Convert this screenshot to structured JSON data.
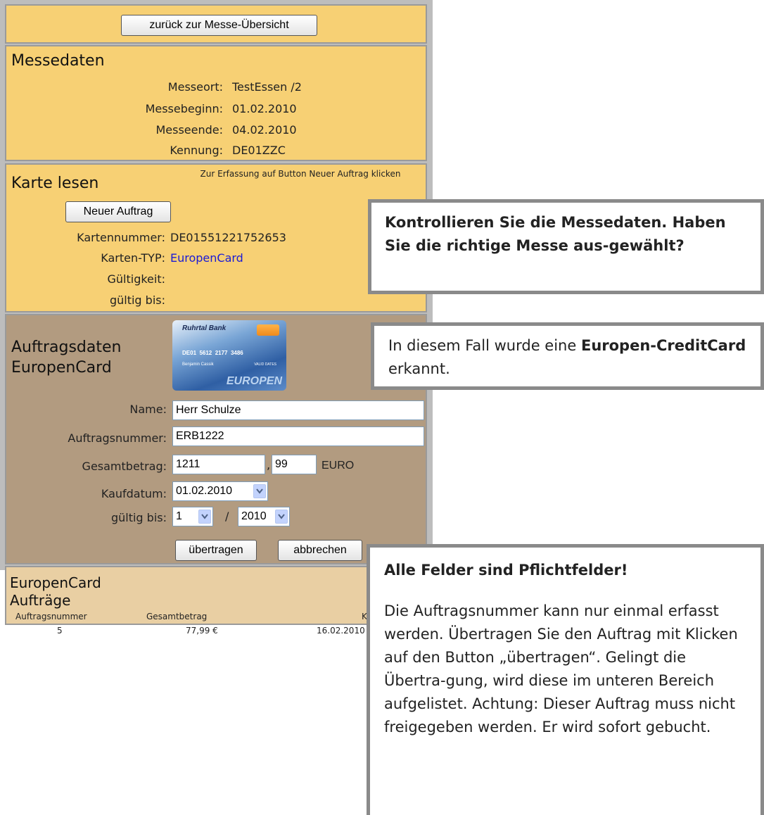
{
  "back_button": "zurück zur Messe-Übersicht",
  "messedaten": {
    "title": "Messedaten",
    "rows": [
      {
        "label": "Messeort:",
        "value": "TestEssen /2"
      },
      {
        "label": "Messebeginn:",
        "value": "01.02.2010"
      },
      {
        "label": "Messeende:",
        "value": "04.02.2010"
      },
      {
        "label": "Kennung:",
        "value": "DE01ZZC"
      }
    ]
  },
  "karte": {
    "title": "Karte lesen",
    "hint": "Zur Erfassung auf Button Neuer Auftrag klicken",
    "new_order_button": "Neuer Auftrag",
    "rows": [
      {
        "label": "Kartennummer:",
        "value": "DE01551221752653"
      },
      {
        "label": "Karten-TYP:",
        "value": "EuropenCard"
      },
      {
        "label": "Gültigkeit:",
        "value": ""
      },
      {
        "label": "gültig bis:",
        "value": ""
      }
    ],
    "type_color": "#1a1ad6"
  },
  "auftrag": {
    "title_line1": "Auftragsdaten",
    "title_line2": "EuropenCard",
    "card_image": {
      "bank": "Ruhrtal Bank",
      "number": "DE01  5612  2177  3486",
      "holder": "Benjamin Cassik",
      "valid_label": "VALID DATES",
      "brand": "EUROPEN"
    },
    "name_label": "Name:",
    "name_value": "Herr Schulze",
    "nr_label": "Auftragsnummer:",
    "nr_value": "ERB1222",
    "betrag_label": "Gesamtbetrag:",
    "betrag_euro": "1211",
    "betrag_cent": "99",
    "betrag_comma": ",",
    "currency": "EURO",
    "datum_label": "Kaufdatum:",
    "datum_value": "01.02.2010",
    "bis_label": "gültig bis:",
    "bis_month": "1",
    "bis_sep": "/",
    "bis_year": "2010",
    "submit_button": "übertragen",
    "cancel_button": "abbrechen"
  },
  "auftraege": {
    "title_line1": "EuropenCard",
    "title_line2": "Aufträge",
    "columns": [
      "Auftragsnummer",
      "Gesamtbetrag",
      "K"
    ],
    "rows": [
      [
        "5",
        "77,99 €",
        "16.02.2010"
      ]
    ]
  },
  "callouts": {
    "one": "Kontrollieren Sie die Messedaten. Haben Sie die richtige Messe aus-gewählt?",
    "two_prefix": "In diesem Fall wurde eine ",
    "two_bold": "Europen-CreditCard",
    "two_suffix": " erkannt.",
    "three_heading": "Alle Felder sind Pflichtfelder!",
    "three_body": "Die Auftragsnummer kann nur einmal erfasst werden. Übertragen Sie den Auftrag mit Klicken auf den Button „übertragen“. Gelingt die Übertra-gung, wird diese im unteren Bereich aufgelistet. Achtung: Dieser Auftrag muss nicht freigegeben werden. Er wird sofort gebucht."
  }
}
